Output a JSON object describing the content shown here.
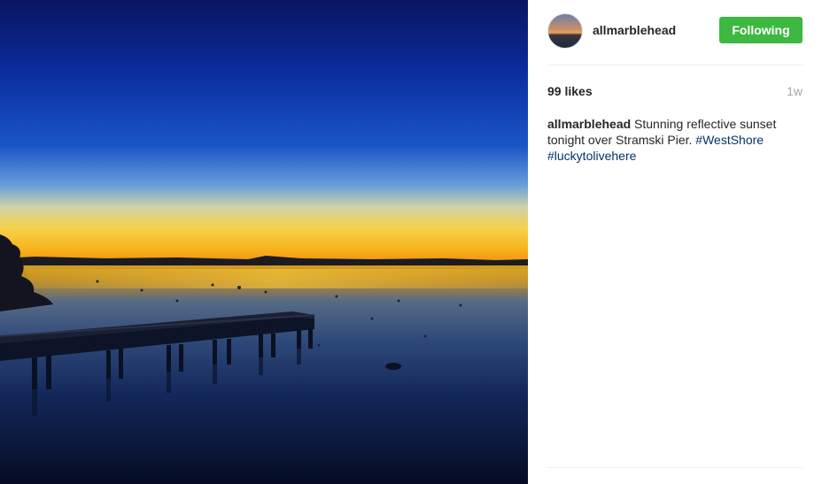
{
  "post": {
    "username": "allmarblehead",
    "follow_label": "Following",
    "likes": "99 likes",
    "time": "1w",
    "caption": {
      "author": "allmarblehead",
      "text": " Stunning reflective sunset tonight over Stramski Pier. ",
      "hashtags": [
        "#WestShore",
        "#luckytolivehere"
      ]
    }
  },
  "colors": {
    "follow_button": "#3db840",
    "hashtag": "#003569",
    "timestamp": "#a5a7aa"
  }
}
